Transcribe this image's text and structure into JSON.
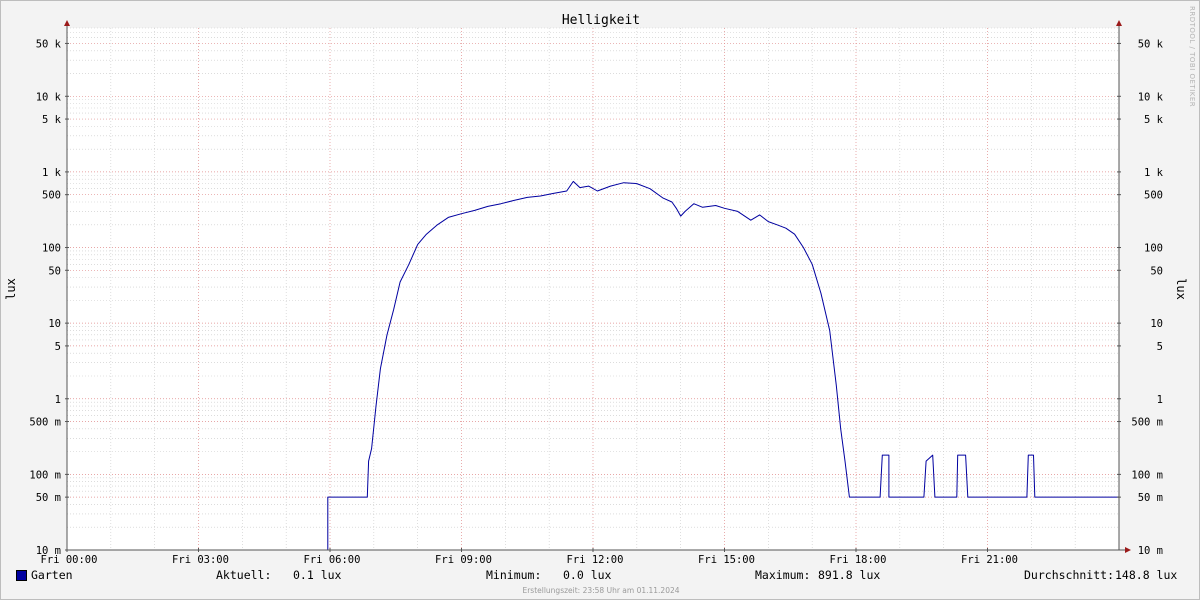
{
  "chart_data": {
    "type": "line",
    "title": "Helligkeit",
    "ylabel": "lux",
    "xlabel": "",
    "yscale": "log",
    "ylim": [
      0.01,
      80000
    ],
    "x_unit": "hours",
    "xlim": [
      0,
      24
    ],
    "x_ticks": [
      {
        "x": 0,
        "label": "Fri 00:00"
      },
      {
        "x": 3,
        "label": "Fri 03:00"
      },
      {
        "x": 6,
        "label": "Fri 06:00"
      },
      {
        "x": 9,
        "label": "Fri 09:00"
      },
      {
        "x": 12,
        "label": "Fri 12:00"
      },
      {
        "x": 15,
        "label": "Fri 15:00"
      },
      {
        "x": 18,
        "label": "Fri 18:00"
      },
      {
        "x": 21,
        "label": "Fri 21:00"
      }
    ],
    "y_ticks": [
      {
        "y": 0.01,
        "label": "10 m"
      },
      {
        "y": 0.05,
        "label": "50 m"
      },
      {
        "y": 0.1,
        "label": "100 m"
      },
      {
        "y": 0.5,
        "label": "500 m"
      },
      {
        "y": 1,
        "label": "1"
      },
      {
        "y": 5,
        "label": "5"
      },
      {
        "y": 10,
        "label": "10"
      },
      {
        "y": 50,
        "label": "50"
      },
      {
        "y": 100,
        "label": "100"
      },
      {
        "y": 500,
        "label": "500"
      },
      {
        "y": 1000,
        "label": "1 k"
      },
      {
        "y": 5000,
        "label": "5 k"
      },
      {
        "y": 10000,
        "label": "10 k"
      },
      {
        "y": 50000,
        "label": "50 k"
      }
    ],
    "grid": true,
    "series": [
      {
        "name": "Garten",
        "color": "#0000a0",
        "points": [
          [
            0,
            0.01
          ],
          [
            5.95,
            0.01
          ],
          [
            5.95,
            0.05
          ],
          [
            6.85,
            0.05
          ],
          [
            6.88,
            0.15
          ],
          [
            6.95,
            0.22
          ],
          [
            7.05,
            0.8
          ],
          [
            7.15,
            2.5
          ],
          [
            7.3,
            7
          ],
          [
            7.45,
            15
          ],
          [
            7.6,
            35
          ],
          [
            7.8,
            60
          ],
          [
            8.0,
            110
          ],
          [
            8.2,
            150
          ],
          [
            8.45,
            200
          ],
          [
            8.7,
            250
          ],
          [
            9.0,
            280
          ],
          [
            9.3,
            310
          ],
          [
            9.6,
            350
          ],
          [
            9.9,
            380
          ],
          [
            10.2,
            420
          ],
          [
            10.5,
            460
          ],
          [
            10.8,
            480
          ],
          [
            11.1,
            520
          ],
          [
            11.4,
            560
          ],
          [
            11.55,
            750
          ],
          [
            11.7,
            620
          ],
          [
            11.9,
            650
          ],
          [
            12.1,
            560
          ],
          [
            12.4,
            650
          ],
          [
            12.7,
            720
          ],
          [
            13.0,
            700
          ],
          [
            13.3,
            600
          ],
          [
            13.6,
            450
          ],
          [
            13.8,
            400
          ],
          [
            13.9,
            330
          ],
          [
            14.0,
            260
          ],
          [
            14.1,
            300
          ],
          [
            14.3,
            380
          ],
          [
            14.5,
            340
          ],
          [
            14.8,
            360
          ],
          [
            15.0,
            330
          ],
          [
            15.3,
            300
          ],
          [
            15.6,
            230
          ],
          [
            15.8,
            270
          ],
          [
            16.0,
            220
          ],
          [
            16.2,
            200
          ],
          [
            16.4,
            180
          ],
          [
            16.6,
            150
          ],
          [
            16.8,
            100
          ],
          [
            17.0,
            60
          ],
          [
            17.2,
            25
          ],
          [
            17.4,
            8
          ],
          [
            17.55,
            1.5
          ],
          [
            17.65,
            0.4
          ],
          [
            17.75,
            0.15
          ],
          [
            17.85,
            0.05
          ],
          [
            18.55,
            0.05
          ],
          [
            18.6,
            0.18
          ],
          [
            18.75,
            0.18
          ],
          [
            18.75,
            0.05
          ],
          [
            19.55,
            0.05
          ],
          [
            19.6,
            0.15
          ],
          [
            19.75,
            0.18
          ],
          [
            19.8,
            0.05
          ],
          [
            20.3,
            0.05
          ],
          [
            20.32,
            0.18
          ],
          [
            20.5,
            0.18
          ],
          [
            20.55,
            0.05
          ],
          [
            21.9,
            0.05
          ],
          [
            21.93,
            0.18
          ],
          [
            22.05,
            0.18
          ],
          [
            22.08,
            0.05
          ],
          [
            24,
            0.05
          ]
        ]
      }
    ]
  },
  "legend": {
    "series_name": "Garten",
    "current_label": "Aktuell:",
    "current_value": "0.1 lux",
    "min_label": "Minimum:",
    "min_value": "0.0 lux",
    "max_label": "Maximum:",
    "max_value": "891.8 lux",
    "avg_label": "Durchschnitt:",
    "avg_value": "148.8 lux"
  },
  "footer": "Erstellungszeit: 23:58 Uhr am 01.11.2024",
  "watermark": "RRDTOOL / TOBI OETIKER",
  "colors": {
    "line": "#0000a0",
    "major_grid": "#e08a8a",
    "minor_grid": "#c8c8c8",
    "axis": "#555555",
    "arrow": "#9b1a1a"
  }
}
